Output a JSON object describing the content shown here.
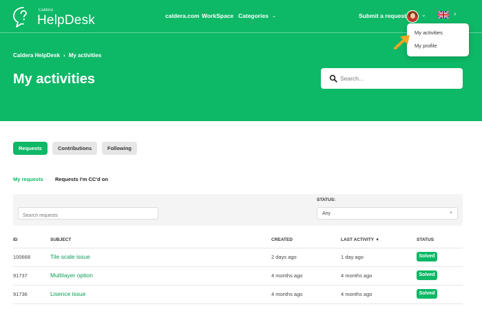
{
  "header": {
    "logo": {
      "small_text": "Caldera",
      "main_text": "HelpDesk",
      "icon": "chat-bubble-question-icon"
    },
    "nav": [
      {
        "label": "caldera.com"
      },
      {
        "label": "WorkSpace"
      },
      {
        "label": "Categories",
        "icon": "chevron-down-icon"
      }
    ],
    "submit_request_label": "Submit a request",
    "avatar_icon": "user-avatar",
    "language_flag_icon": "uk-flag-icon",
    "user_menu": {
      "items": [
        {
          "label": "My activities"
        },
        {
          "label": "My profile"
        }
      ]
    }
  },
  "breadcrumb": [
    {
      "label": "Caldera HelpDesk"
    },
    {
      "label": "My activities"
    }
  ],
  "breadcrumb_separator": "›",
  "page_title": "My activities",
  "hero_search": {
    "placeholder": "Search...",
    "icon": "search-icon"
  },
  "tabs": [
    {
      "label": "Requests",
      "active": true
    },
    {
      "label": "Contributions",
      "active": false
    },
    {
      "label": "Following",
      "active": false
    }
  ],
  "subtabs": [
    {
      "label": "My requests",
      "active": true
    },
    {
      "label": "Requests I'm CC'd on",
      "active": false
    }
  ],
  "subtab_separator": "·",
  "filters": {
    "search_placeholder": "Search requests",
    "status_label": "STATUS:",
    "status_value": "Any"
  },
  "table": {
    "columns": [
      "ID",
      "SUBJECT",
      "CREATED",
      "LAST ACTIVITY",
      "STATUS"
    ],
    "sort_column": "LAST ACTIVITY",
    "sort_icon": "sort-desc-icon",
    "rows": [
      {
        "id": "100668",
        "subject": "Tile scale issue",
        "created": "2 days ago",
        "last_activity": "1 day ago",
        "status": "Solved"
      },
      {
        "id": "91737",
        "subject": "Multilayer option",
        "created": "4 months ago",
        "last_activity": "4 months ago",
        "status": "Solved"
      },
      {
        "id": "91736",
        "subject": "Lisence issue",
        "created": "4 months ago",
        "last_activity": "4 months ago",
        "status": "Solved"
      }
    ]
  },
  "colors": {
    "brand_green": "#0db866",
    "link_green": "#0a9c55",
    "annotation_arrow": "#f5a623"
  }
}
